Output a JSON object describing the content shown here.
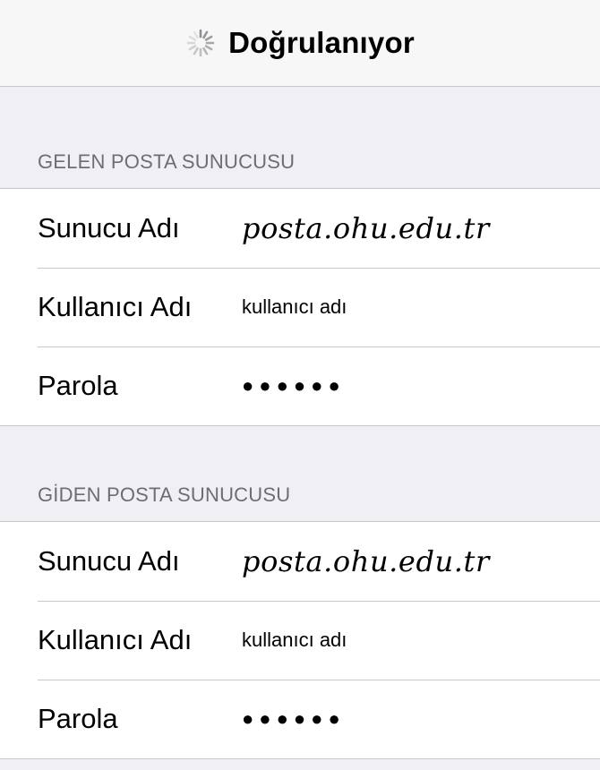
{
  "navbar": {
    "title": "Doğrulanıyor",
    "spinner_icon": "activity-spinner-icon"
  },
  "incoming": {
    "header": "GELEN POSTA SUNUCUSU",
    "rows": [
      {
        "label": "Sunucu Adı",
        "value": "posta.ohu.edu.tr"
      },
      {
        "label": "Kullanıcı Adı",
        "value": "kullanıcı adı"
      },
      {
        "label": "Parola",
        "value": "●●●●●●"
      }
    ]
  },
  "outgoing": {
    "header": "GİDEN POSTA SUNUCUSU",
    "rows": [
      {
        "label": "Sunucu Adı",
        "value": "posta.ohu.edu.tr"
      },
      {
        "label": "Kullanıcı Adı",
        "value": "kullanıcı adı"
      },
      {
        "label": "Parola",
        "value": "●●●●●●"
      }
    ]
  },
  "colors": {
    "background": "#efeff4",
    "navbar": "#f7f7f7",
    "separator": "#c8c7cc",
    "section_header_text": "#6d6d72"
  }
}
